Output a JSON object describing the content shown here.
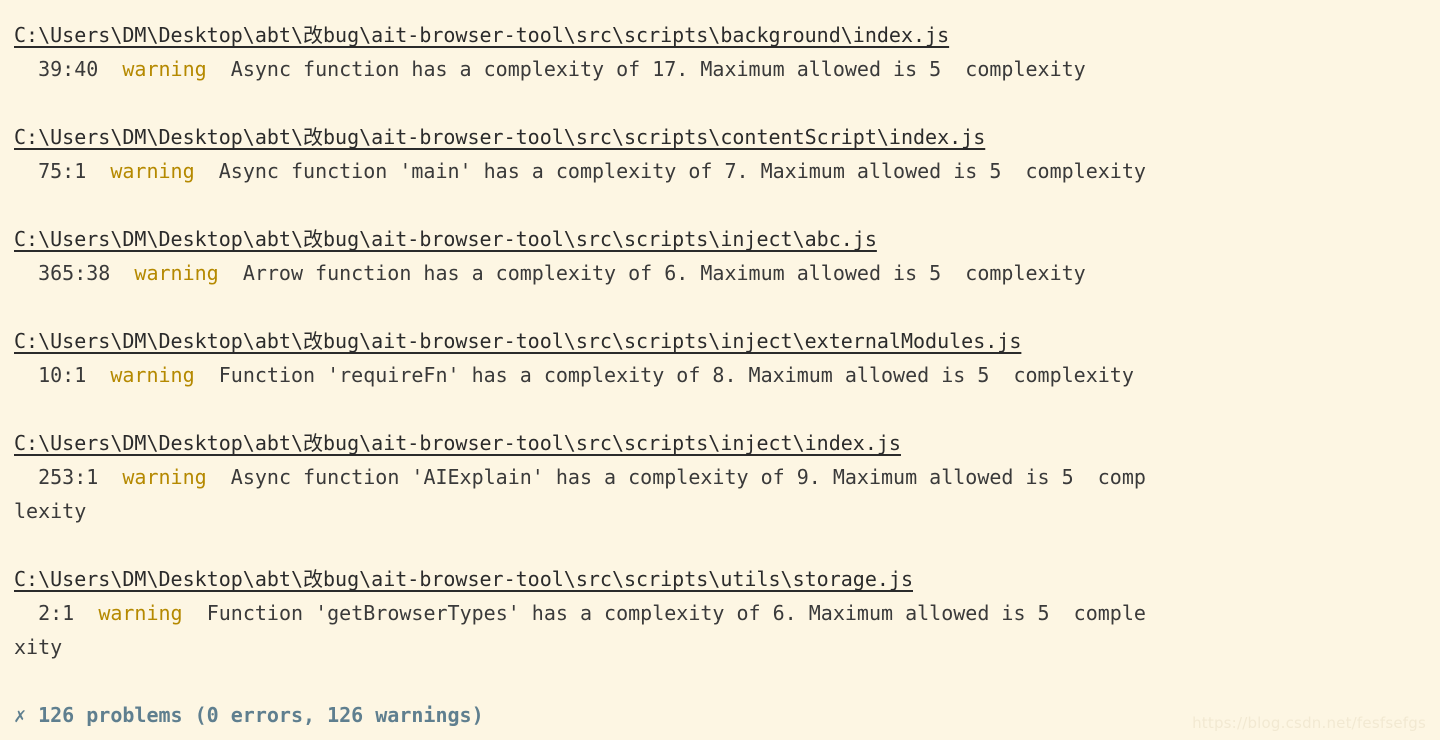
{
  "terminal": {
    "background_color": "#fdf6e3",
    "foreground_color": "#3a3a3a",
    "warning_color": "#b58900",
    "summary_color": "#5f7f8f",
    "font_size_px": 20,
    "line_height_px": 34,
    "columns": 78
  },
  "blocks": [
    {
      "filepath": "C:\\Users\\DM\\Desktop\\abt\\改bug\\ait-browser-tool\\src\\scripts\\background\\index.js",
      "messages": [
        {
          "location": "  39:40",
          "severity": "warning",
          "message": "Async function has a complexity of 17. Maximum allowed is 5",
          "rule": "complexity",
          "wrapped_tail": ""
        }
      ]
    },
    {
      "filepath": "C:\\Users\\DM\\Desktop\\abt\\改bug\\ait-browser-tool\\src\\scripts\\contentScript\\index.js",
      "messages": [
        {
          "location": "  75:1",
          "severity": "warning",
          "message": "Async function 'main' has a complexity of 7. Maximum allowed is 5",
          "rule": "complexity",
          "wrapped_tail": ""
        }
      ]
    },
    {
      "filepath": "C:\\Users\\DM\\Desktop\\abt\\改bug\\ait-browser-tool\\src\\scripts\\inject\\abc.js",
      "messages": [
        {
          "location": "  365:38",
          "severity": "warning",
          "message": "Arrow function has a complexity of 6. Maximum allowed is 5",
          "rule": "complexity",
          "wrapped_tail": ""
        }
      ]
    },
    {
      "filepath": "C:\\Users\\DM\\Desktop\\abt\\改bug\\ait-browser-tool\\src\\scripts\\inject\\externalModules.js",
      "messages": [
        {
          "location": "  10:1",
          "severity": "warning",
          "message": "Function 'requireFn' has a complexity of 8. Maximum allowed is 5",
          "rule": "complexity",
          "wrapped_tail": ""
        }
      ]
    },
    {
      "filepath": "C:\\Users\\DM\\Desktop\\abt\\改bug\\ait-browser-tool\\src\\scripts\\inject\\index.js",
      "messages": [
        {
          "location": "  253:1",
          "severity": "warning",
          "message": "Async function 'AIExplain' has a complexity of 9. Maximum allowed is 5",
          "rule": "comp",
          "wrapped_tail": "lexity"
        }
      ]
    },
    {
      "filepath": "C:\\Users\\DM\\Desktop\\abt\\改bug\\ait-browser-tool\\src\\scripts\\utils\\storage.js",
      "messages": [
        {
          "location": "  2:1",
          "severity": "warning",
          "message": "Function 'getBrowserTypes' has a complexity of 6. Maximum allowed is 5",
          "rule": "comple",
          "wrapped_tail": "xity"
        }
      ]
    }
  ],
  "summary": {
    "icon": "✗",
    "text": "126 problems (0 errors, 126 warnings)",
    "total_problems": 126,
    "errors": 0,
    "warnings": 126
  },
  "watermark": {
    "text": "https://blog.csdn.net/fesfsefgs"
  }
}
